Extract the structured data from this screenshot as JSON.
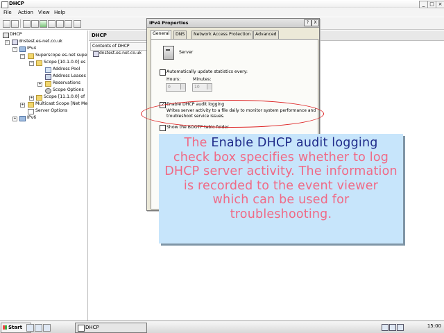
{
  "window": {
    "title": "DHCP",
    "controls": [
      "_",
      "□",
      "×"
    ]
  },
  "menu": [
    "File",
    "Action",
    "View",
    "Help"
  ],
  "tree": {
    "root": "DHCP",
    "server": "dnstest.es-net.co.uk",
    "ipv4": "IPv4",
    "superscope": "Superscope es-net supe",
    "scope1": "Scope [10.1.0.0] es",
    "address_pool": "Address Pool",
    "address_leases": "Address Leases",
    "reservations": "Reservations",
    "scope_options": "Scope Options",
    "scope2": "Scope [11.1.0.0] of",
    "multicast": "Multicast Scope [Net Me",
    "server_options": "Server Options",
    "ipv6": "IPv6"
  },
  "right_pane": {
    "header": "DHCP",
    "column": "Contents of DHCP",
    "item": "dnstest.es-net.co.uk"
  },
  "dialog": {
    "title": "IPv4 Properties",
    "help": "?",
    "close": "X",
    "tabs": [
      "General",
      "DNS",
      "Network Access Protection",
      "Advanced"
    ],
    "active_tab": "General",
    "server_label": "Server",
    "auto_update": {
      "label": "Automatically update statistics every:",
      "checked": false
    },
    "hours_label": "Hours:",
    "minutes_label": "Minutes:",
    "hours_value": "0",
    "minutes_value": "10",
    "audit": {
      "label": "Enable DHCP audit logging",
      "checked": true,
      "desc1": "Writes server activity to a file daily to monitor system performance and",
      "desc2": "troubleshoot service issues."
    },
    "bootp": {
      "label": "Show the BOOTP table folder",
      "checked": false
    }
  },
  "callout": {
    "pre": "The",
    "highlight": "Enable DHCP audit logging",
    "post": "check box specifies whether to log DHCP server activity. The information is recorded to the event viewer which can be used for troubleshooting."
  },
  "taskbar": {
    "start": "Start",
    "task": "DHCP",
    "clock": "15:00"
  },
  "colors": {
    "callout_bg": "#c7e5fb",
    "callout_text": "#f06a86",
    "callout_highlight": "#1f2b8a",
    "oval": "#dd2222"
  }
}
